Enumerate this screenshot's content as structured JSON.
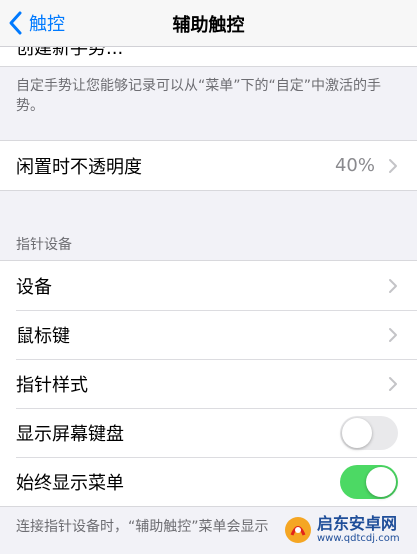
{
  "nav": {
    "back_label": "触控",
    "title": "辅助触控"
  },
  "partial_row_label": "创建新手势...",
  "custom_gesture_footnote": "自定手势让您能够记录可以从“菜单”下的“自定”中激活的手势。",
  "idle_opacity": {
    "label": "闲置时不透明度",
    "value": "40%"
  },
  "pointer_section": {
    "header": "指针设备",
    "rows": [
      {
        "label": "设备"
      },
      {
        "label": "鼠标键"
      },
      {
        "label": "指针样式"
      }
    ],
    "toggles": [
      {
        "label": "显示屏幕键盘",
        "state": "off"
      },
      {
        "label": "始终显示菜单",
        "state": "on"
      }
    ]
  },
  "bottom_footnote": "连接指针设备时，“辅助触控”菜单会显示",
  "watermark": {
    "title": "启东安卓网",
    "url": "www.qdtcdj.com"
  },
  "colors": {
    "accent": "#007aff",
    "toggle_on": "#4cd964",
    "toggle_off": "#e9e9eb",
    "background": "#f2f2f7"
  }
}
